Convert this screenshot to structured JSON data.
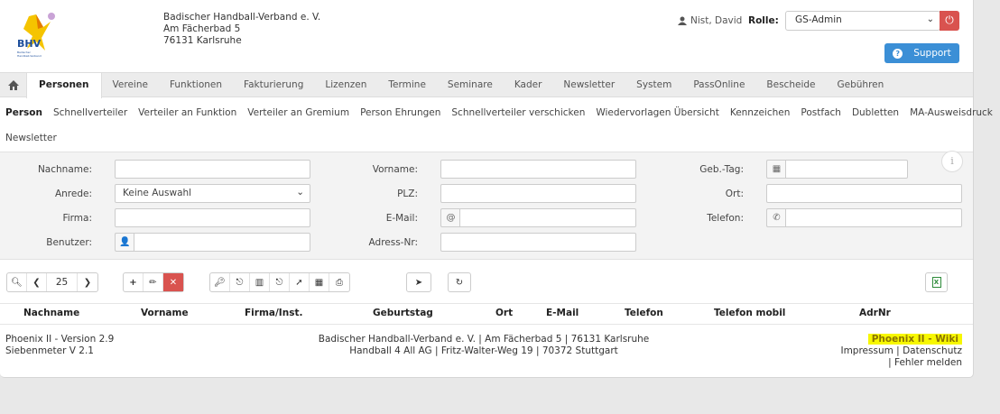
{
  "org": {
    "logo_text": "BHV",
    "logo_subtext": "Badischer Handball-Verband",
    "name": "Badischer Handball-Verband e. V.",
    "street": "Am Fächerbad 5",
    "city": "76131 Karlsruhe"
  },
  "user": {
    "name": "Nist, David",
    "icon": "user-icon"
  },
  "role": {
    "label": "Rolle:",
    "value": "GS-Admin"
  },
  "support_label": "Support",
  "main_nav": {
    "tabs": [
      "Personen",
      "Vereine",
      "Funktionen",
      "Fakturierung",
      "Lizenzen",
      "Termine",
      "Seminare",
      "Kader",
      "Newsletter",
      "System",
      "PassOnline",
      "Bescheide",
      "Gebühren"
    ],
    "active": "Personen"
  },
  "sub_nav": {
    "items": [
      "Person",
      "Schnellverteiler",
      "Verteiler an Funktion",
      "Verteiler an Gremium",
      "Person Ehrungen",
      "Schnellverteiler verschicken",
      "Wiedervorlagen Übersicht",
      "Kennzeichen",
      "Postfach",
      "Dubletten",
      "MA-Ausweisdruck"
    ],
    "row2": "Newsletter",
    "active": "Person"
  },
  "filter": {
    "nachname_label": "Nachname:",
    "anrede_label": "Anrede:",
    "anrede_value": "Keine Auswahl",
    "firma_label": "Firma:",
    "benutzer_label": "Benutzer:",
    "vorname_label": "Vorname:",
    "plz_label": "PLZ:",
    "email_label": "E-Mail:",
    "email_addon": "@",
    "adressnr_label": "Adress-Nr:",
    "gebtag_label": "Geb.-Tag:",
    "ort_label": "Ort:",
    "telefon_label": "Telefon:"
  },
  "toolbar": {
    "page_size": "25"
  },
  "table": {
    "columns": [
      "Nachname",
      "Vorname",
      "Firma/Inst.",
      "Geburtstag",
      "Ort",
      "E-Mail",
      "Telefon",
      "Telefon mobil",
      "AdrNr"
    ]
  },
  "footer": {
    "version": "Phoenix II - Version 2.9",
    "siebenmeter": "Siebenmeter V 2.1",
    "center_line1": "Badischer Handball-Verband e. V. | Am Fächerbad 5 | 76131 Karlsruhe",
    "center_line2": "Handball 4 All AG | Fritz-Walter-Weg 19 | 70372 Stuttgart",
    "wiki": "Phoenix II - Wiki",
    "impressum": "Impressum",
    "datenschutz": "Datenschutz",
    "fehler": "Fehler melden"
  },
  "colors": {
    "accent_blue": "#3b8fd6",
    "danger_red": "#d9534f",
    "highlight": "#f7f700"
  }
}
